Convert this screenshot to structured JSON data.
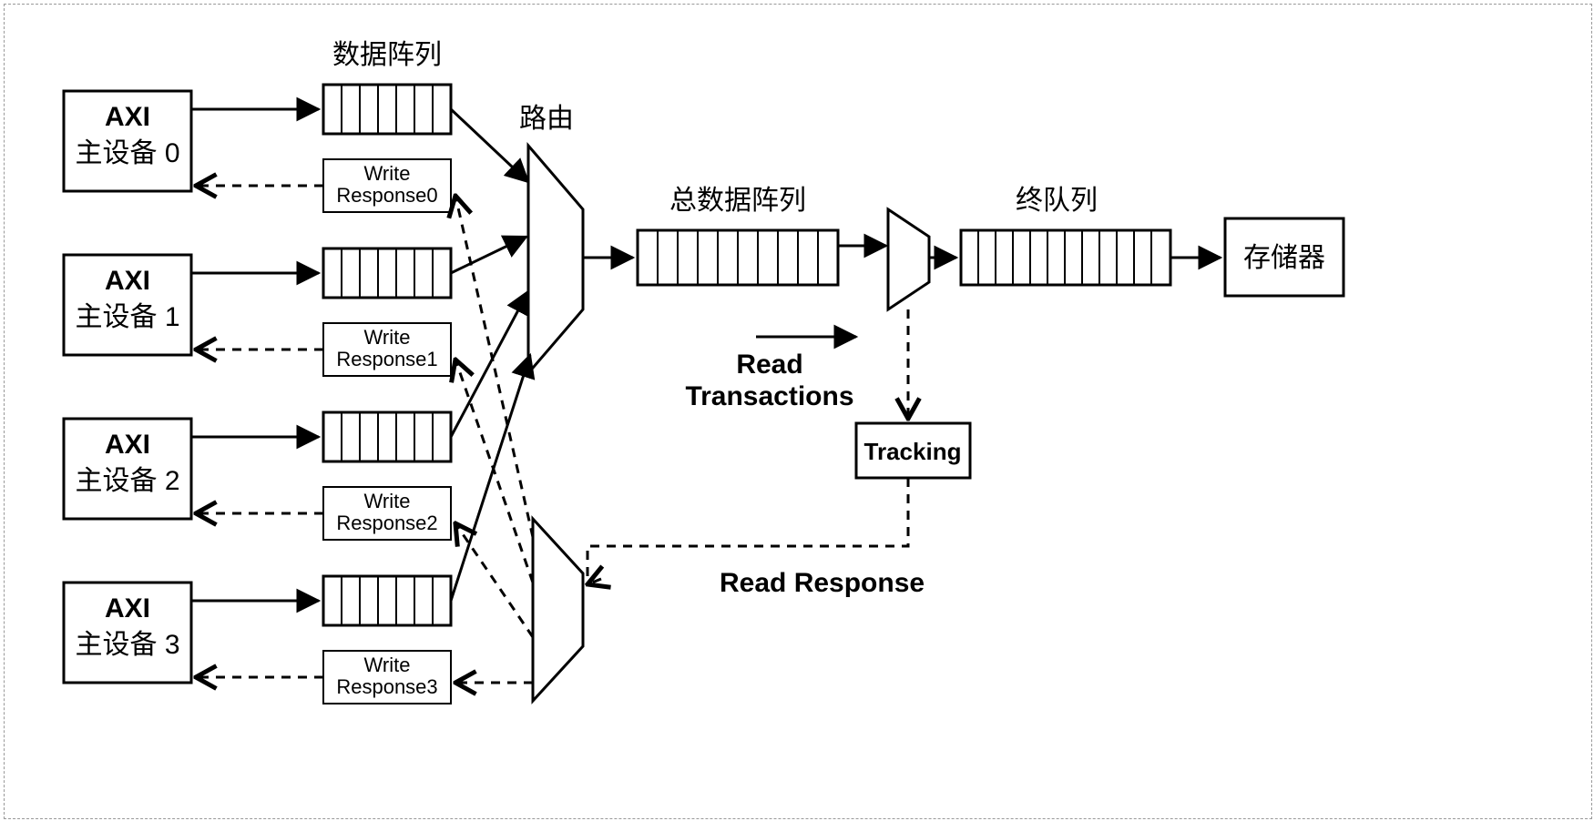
{
  "labels": {
    "data_array": "数据阵列",
    "route": "路由",
    "total_data_array": "总数据阵列",
    "final_queue": "终队列",
    "read_line1": "Read",
    "read_line2": "Transactions",
    "read_response": "Read Response",
    "tracking": "Tracking",
    "storage": "存储器"
  },
  "masters": [
    {
      "line1": "AXI",
      "line2": "主设备 0",
      "wr1": "Write",
      "wr2": "Response0"
    },
    {
      "line1": "AXI",
      "line2": "主设备 1",
      "wr1": "Write",
      "wr2": "Response1"
    },
    {
      "line1": "AXI",
      "line2": "主设备 2",
      "wr1": "Write",
      "wr2": "Response2"
    },
    {
      "line1": "AXI",
      "line2": "主设备 3",
      "wr1": "Write",
      "wr2": "Response3"
    }
  ]
}
